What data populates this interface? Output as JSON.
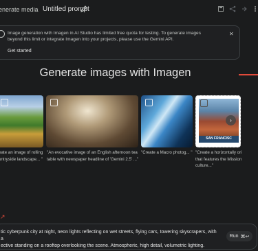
{
  "header": {
    "breadcrumb": "enerate media",
    "separator": "›",
    "prompt_title": "Untitled prompt"
  },
  "banner": {
    "message": "Image generation with Imagen in AI Studio has limited free quota for testing. To generate images beyond this limit or integrate Imagen into your projects, please use the Gemini API.",
    "cta": "Get started",
    "close": "✕"
  },
  "main": {
    "heading": "Generate images with Imagen"
  },
  "cards": [
    {
      "caption": "eate an image of rolling\nuntryside landscape... \""
    },
    {
      "caption": "\"An evocative image of an English afternoon tea\ntable with newspaper headline of 'Gemini 2.5' ...\""
    },
    {
      "caption": "\"Create a Macro photog... \""
    },
    {
      "caption": "\"Create a horizontally ori\nthat features the Mission\nculture...\"",
      "stamp_text": "SAN FRANCISC"
    }
  ],
  "carousel": {
    "next_icon": "›"
  },
  "prompt": {
    "text": "tic cyberpunk city at night, neon lights reflecting on wet streets, flying cars, towering skyscrapers, with a\nective standing on a rooftop overlooking the scene. Atmospheric, high detail, volumetric lighting.",
    "run_label": "Run",
    "run_shortcut": "⌘↩"
  },
  "colors": {
    "accent": "#e04a3a",
    "background": "#1b1c1d"
  }
}
